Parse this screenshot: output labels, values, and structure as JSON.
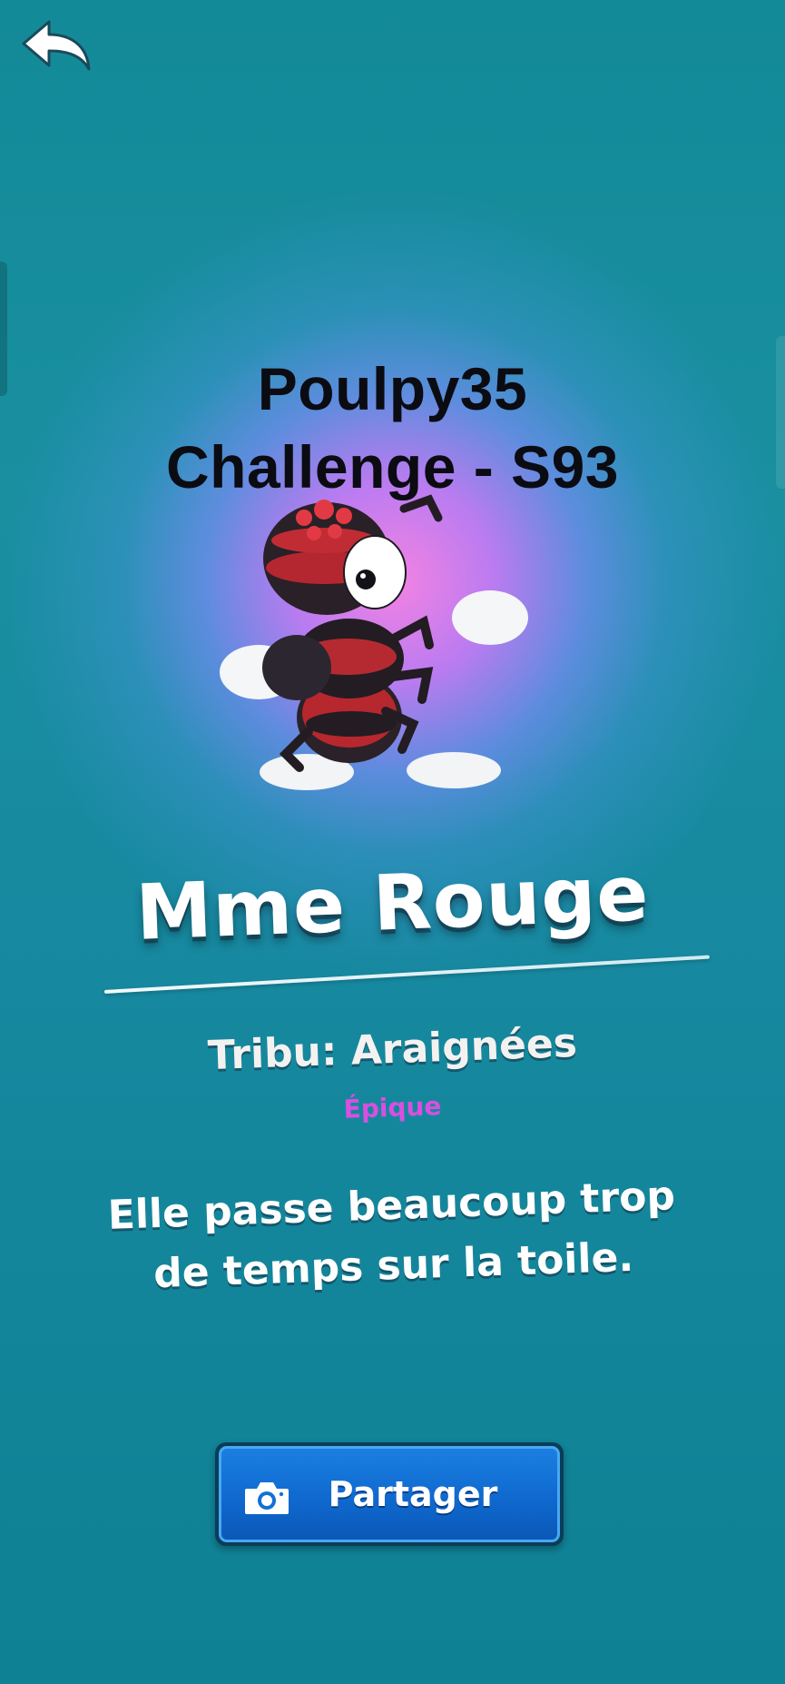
{
  "header": {
    "back_icon": "back-arrow-icon"
  },
  "title": {
    "line1": "Poulpy35",
    "line2": "Challenge - S93"
  },
  "character": {
    "name": "Mme Rouge",
    "tribe": "Tribu: Araignées",
    "rarity": "Épique",
    "description_line1": "Elle passe beaucoup trop",
    "description_line2": "de temps sur la toile."
  },
  "share": {
    "label": "Partager",
    "icon": "camera-icon"
  },
  "colors": {
    "background": "#0d8a98",
    "glow": "#ff82e6",
    "rarity": "#d94fe0",
    "button": "#1b7fe0"
  }
}
